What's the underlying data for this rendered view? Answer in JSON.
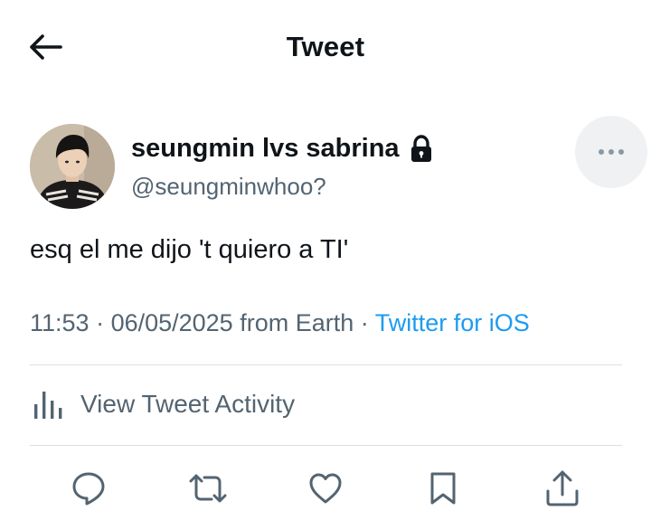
{
  "header": {
    "title": "Tweet",
    "back_icon": "arrow-left-icon"
  },
  "author": {
    "display_name": "seungmin lvs sabrina",
    "handle": "@seungminwhoo?",
    "protected_icon": "lock-icon",
    "more_icon": "more-horizontal-icon"
  },
  "tweet": {
    "text": "esq el me dijo 't quiero a TI'",
    "time": "11:53",
    "separator": " · ",
    "date": "06/05/2025",
    "location": " from Earth",
    "source": "Twitter for iOS"
  },
  "activity": {
    "label": "View Tweet Activity",
    "icon": "bar-chart-icon"
  },
  "actions": {
    "icons": [
      "reply-icon",
      "retweet-icon",
      "like-icon",
      "bookmark-icon",
      "share-icon"
    ]
  },
  "colors": {
    "text_primary": "#0f1419",
    "text_secondary": "#536471",
    "link": "#1d9bf0",
    "divider": "#dcdfe2",
    "more_bg": "#eff1f3"
  }
}
